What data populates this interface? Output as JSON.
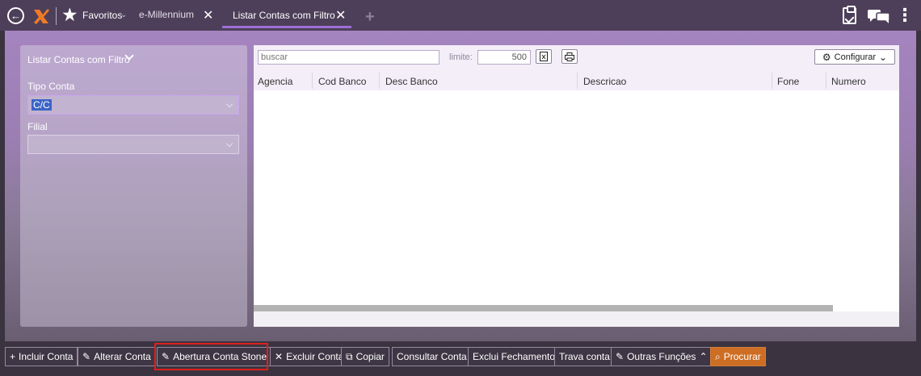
{
  "topbar": {
    "favorites_label": "Favoritos",
    "favorites_caret": "⌄",
    "tabs": [
      {
        "label": "e-Millennium",
        "close": "✕"
      },
      {
        "label": "Listar Contas com Filtro",
        "close": "✕"
      }
    ],
    "add_tab": "+",
    "icons": [
      "back-icon",
      "logo-icon",
      "star-icon",
      "clipboard-icon",
      "chat-icon",
      "more-vertical-icon"
    ]
  },
  "filters": {
    "title": "Listar Contas com Filtro",
    "tipo_conta_label": "Tipo Conta",
    "tipo_conta_value": "C/C",
    "filial_label": "Filial",
    "filial_value": ""
  },
  "grid": {
    "search_placeholder": "buscar",
    "limit_label": "limite:",
    "limit_value": "500",
    "configure_label": "Configurar",
    "columns": [
      "Agencia",
      "Cod Banco",
      "Desc Banco",
      "Descricao",
      "Fone",
      "Numero"
    ],
    "rows": []
  },
  "toolbar": {
    "buttons": [
      {
        "label": "Incluir Conta",
        "icon": "plus-icon",
        "glyph": "+"
      },
      {
        "label": "Alterar Conta",
        "icon": "edit-icon",
        "glyph": "✎"
      },
      {
        "label": "Abertura Conta Stone",
        "icon": "edit-icon",
        "glyph": "✎"
      },
      {
        "label": "Excluir Conta",
        "icon": "close-icon",
        "glyph": "✕"
      },
      {
        "label": "Copiar",
        "icon": "copy-icon",
        "glyph": "⧉"
      },
      {
        "label": "Consultar Conta",
        "icon": "",
        "glyph": ""
      },
      {
        "label": "Exclui Fechamento",
        "icon": "",
        "glyph": ""
      },
      {
        "label": "Trava conta",
        "icon": "",
        "glyph": ""
      },
      {
        "label": "Outras Funções",
        "icon": "external-edit-icon",
        "glyph": "✎"
      },
      {
        "label": "Procurar",
        "icon": "search-icon",
        "glyph": "⌕"
      }
    ],
    "highlighted_button": "Abertura Conta Stone"
  },
  "colors": {
    "topbar_bg": "#4d3f59",
    "active_tab_underline": "#9d6fd6",
    "primary_button": "#cd6e24",
    "highlight_border": "#e0201c",
    "selected_text_bg": "#3d64c6"
  }
}
